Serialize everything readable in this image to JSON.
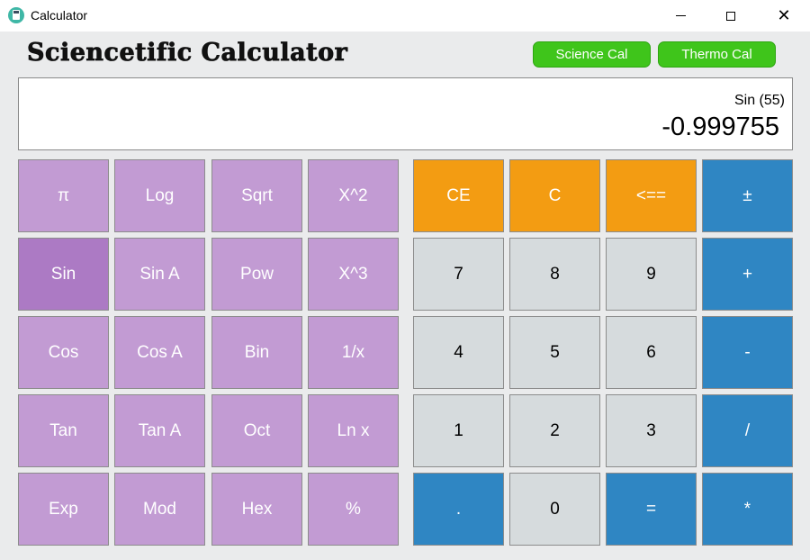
{
  "window": {
    "title": "Calculator"
  },
  "header": {
    "heading": "Sciencetific Calculator",
    "science_label": "Science Cal",
    "thermo_label": "Thermo Cal"
  },
  "display": {
    "expression": "Sin (55)",
    "result": "-0.999755"
  },
  "keys": {
    "sci": [
      [
        "π",
        "Log",
        "Sqrt",
        "X^2"
      ],
      [
        "Sin",
        "Sin A",
        "Pow",
        "X^3"
      ],
      [
        "Cos",
        "Cos A",
        "Bin",
        "1/x"
      ],
      [
        "Tan",
        "Tan A",
        "Oct",
        "Ln x"
      ],
      [
        "Exp",
        "Mod",
        "Hex",
        "%"
      ]
    ],
    "std": [
      [
        "CE",
        "C",
        "<==",
        "±"
      ],
      [
        "7",
        "8",
        "9",
        "+"
      ],
      [
        "4",
        "5",
        "6",
        "-"
      ],
      [
        "1",
        "2",
        "3",
        "/"
      ],
      [
        ".",
        "0",
        "=",
        "*"
      ]
    ]
  },
  "colors": {
    "sci_key": "#c29bd3",
    "sci_key_active": "#ac7ac4",
    "orange_key": "#f39c12",
    "blue_key": "#2f86c3",
    "gray_key": "#d6dbdd",
    "mode_button": "#3fc51b"
  },
  "icons": {
    "app": "calculator-icon",
    "minimize": "minimize-icon",
    "maximize": "maximize-icon",
    "close": "close-icon"
  }
}
